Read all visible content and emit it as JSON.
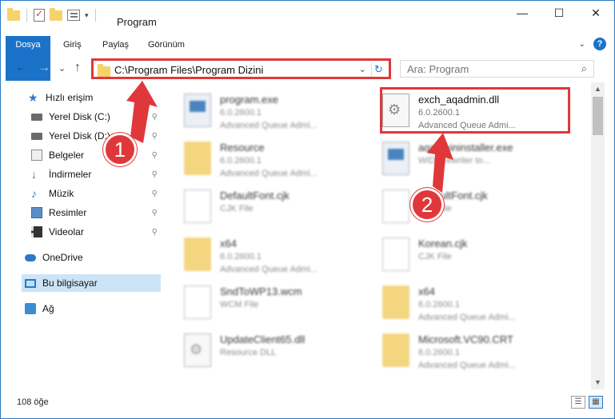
{
  "window": {
    "title": "Program",
    "controls": {
      "minimize": "—",
      "maximize": "☐",
      "close": "✕"
    }
  },
  "quick_access_toolbar": {
    "dropdown": "▾"
  },
  "ribbon": {
    "tabs": [
      "Dosya",
      "Giriş",
      "Paylaş",
      "Görünüm"
    ],
    "expand_chevron": "⌄",
    "help": "?"
  },
  "navigation": {
    "back": "←",
    "forward": "→",
    "recent": "⌄",
    "up": "↑",
    "address_path": "C:\\Program Files\\Program Dizini",
    "address_dropdown": "⌄",
    "refresh": "↻",
    "search_placeholder": "Ara: Program",
    "search_icon": "⌕"
  },
  "sidebar": {
    "items": [
      {
        "label": "Hızlı erişim",
        "icon": "star-icon",
        "pinned": false
      },
      {
        "label": "Yerel Disk (C:)",
        "icon": "disk-icon",
        "pinned": true
      },
      {
        "label": "Yerel Disk (D:)",
        "icon": "disk-icon",
        "pinned": true
      },
      {
        "label": "Belgeler",
        "icon": "documents-icon",
        "pinned": true
      },
      {
        "label": "İndirmeler",
        "icon": "download-icon",
        "pinned": true
      },
      {
        "label": "Müzik",
        "icon": "music-icon",
        "pinned": true
      },
      {
        "label": "Resimler",
        "icon": "pictures-icon",
        "pinned": true
      },
      {
        "label": "Videolar",
        "icon": "videos-icon",
        "pinned": true
      },
      {
        "label": "OneDrive",
        "icon": "cloud-icon",
        "pinned": false
      },
      {
        "label": "Bu bilgisayar",
        "icon": "computer-icon",
        "pinned": false,
        "selected": true
      },
      {
        "label": "Ağ",
        "icon": "network-icon",
        "pinned": false
      }
    ],
    "pin_glyph": "⚲"
  },
  "files": [
    {
      "name": "program.exe",
      "l2": "6.0.2600.1",
      "l3": "Advanced Queue Admi...",
      "type": "exe",
      "blurred": true
    },
    {
      "name": "exch_aqadmin.dll",
      "l2": "6.0.2600.1",
      "l3": "Advanced Queue Admi...",
      "type": "dll",
      "blurred": false
    },
    {
      "name": "Resource",
      "l2": "6.0.2600.1",
      "l3": "Advanced Queue Admi...",
      "type": "folder",
      "blurred": true
    },
    {
      "name": "aqadmininstaller.exe",
      "l2": "WIDI Rewriter to...",
      "l3": "",
      "type": "exe",
      "blurred": true
    },
    {
      "name": "DefaultFont.cjk",
      "l2": "CJK File",
      "l3": "",
      "type": "doc",
      "blurred": true
    },
    {
      "name": "DefaultFont.cjk",
      "l2": "CJK File",
      "l3": "",
      "type": "doc",
      "blurred": true
    },
    {
      "name": "x64",
      "l2": "6.0.2600.1",
      "l3": "Advanced Queue Admi...",
      "type": "folder",
      "blurred": true
    },
    {
      "name": "Korean.cjk",
      "l2": "CJK File",
      "l3": "",
      "type": "doc",
      "blurred": true
    },
    {
      "name": "SndToWP13.wcm",
      "l2": "WCM File",
      "l3": "",
      "type": "doc",
      "blurred": true
    },
    {
      "name": "x64",
      "l2": "6.0.2600.1",
      "l3": "Advanced Queue Admi...",
      "type": "folder",
      "blurred": true
    },
    {
      "name": "UpdateClient65.dll",
      "l2": "Resource DLL",
      "l3": "",
      "type": "dll",
      "blurred": true
    },
    {
      "name": "Microsoft.VC90.CRT",
      "l2": "6.0.2600.1",
      "l3": "Advanced Queue Admi...",
      "type": "folder",
      "blurred": true
    }
  ],
  "status": {
    "count": "108 öğe",
    "details_view": "☰",
    "tiles_view": "▦"
  },
  "scrollbar": {
    "up": "▲",
    "down": "▼"
  },
  "annotations": {
    "step1": "1",
    "step2": "2",
    "color": "#e0383a"
  }
}
